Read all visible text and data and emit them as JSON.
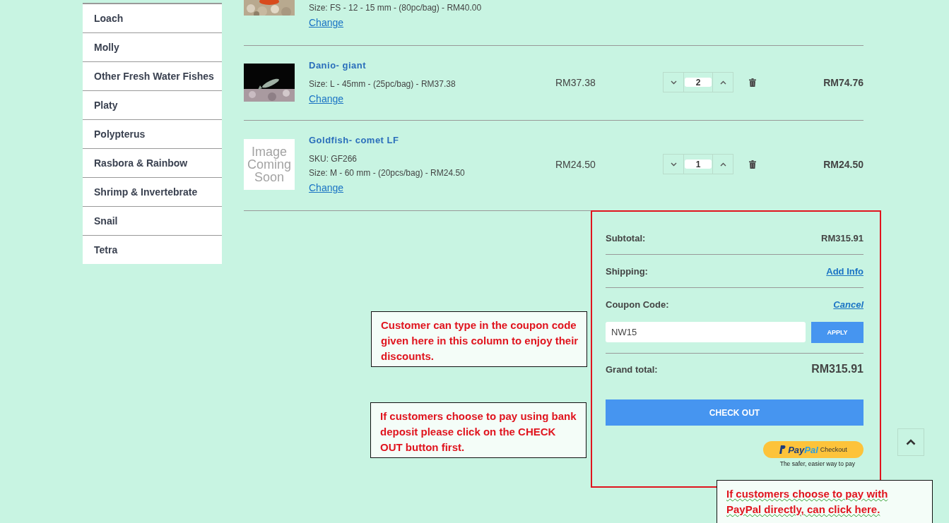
{
  "sidebar": {
    "items": [
      {
        "label": "Loach"
      },
      {
        "label": "Molly"
      },
      {
        "label": "Other Fresh Water Fishes"
      },
      {
        "label": "Platy"
      },
      {
        "label": "Polypterus"
      },
      {
        "label": "Rasbora & Rainbow"
      },
      {
        "label": "Shrimp & Invertebrate"
      },
      {
        "label": "Snail"
      },
      {
        "label": "Tetra"
      }
    ]
  },
  "cart": {
    "items": [
      {
        "size": "Size:  FS - 12 - 15 mm - (80pc/bag) - RM40.00",
        "change": "Change"
      },
      {
        "name": "Danio- giant",
        "size": "Size:  L - 45mm - (25pc/bag) - RM37.38",
        "change": "Change",
        "price": "RM37.38",
        "qty": "2",
        "total": "RM74.76"
      },
      {
        "image": {
          "kind": "placeholder",
          "text": "Image Coming Soon"
        },
        "name": "Goldfish- comet LF",
        "sku": "SKU:  GF266",
        "size": "Size:  M - 60 mm - (20pcs/bag) - RM24.50",
        "change": "Change",
        "price": "RM24.50",
        "qty": "1",
        "total": "RM24.50"
      }
    ]
  },
  "summary": {
    "subtotal_label": "Subtotal:",
    "subtotal": "RM315.91",
    "shipping_label": "Shipping:",
    "shipping_link": "Add Info",
    "coupon_label": "Coupon Code:",
    "coupon_cancel": "Cancel",
    "coupon_value": "NW15",
    "apply": "APPLY",
    "grand_total_label": "Grand total:",
    "grand_total": "RM315.91",
    "checkout": "CHECK OUT",
    "paypal": {
      "pay": "Pay",
      "pal": "Pal",
      "checkout": "Checkout",
      "tagline": "The safer, easier way to pay"
    }
  },
  "annotations": [
    {
      "text": "Customer can type in the coupon code given here in this column to enjoy their discounts.",
      "spellcheck": false
    },
    {
      "text": "If customers choose to pay using bank deposit please click on the CHECK OUT button first.",
      "spellcheck": false
    },
    {
      "text": "If customers choose to pay with PayPal directly, can click here.",
      "spellcheck": true
    }
  ]
}
